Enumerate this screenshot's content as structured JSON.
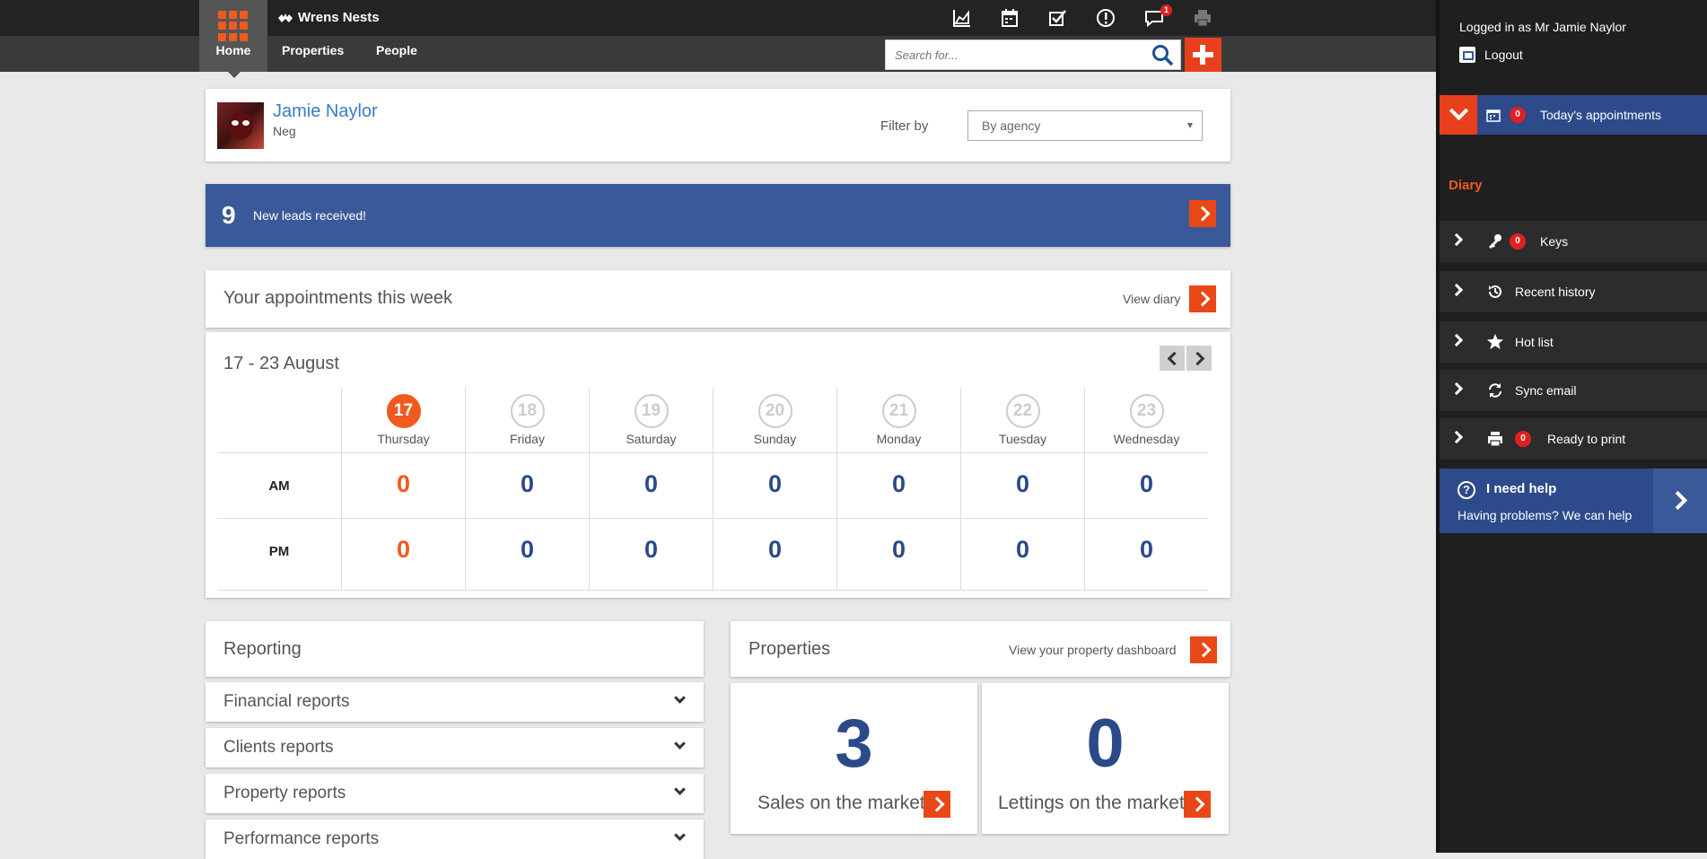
{
  "header": {
    "brand": "Wrens Nests",
    "nav": {
      "home": "Home",
      "properties": "Properties",
      "people": "People"
    },
    "icons": [
      "chart-icon",
      "calendar-icon",
      "checklist-icon",
      "alert-icon",
      "messages-icon",
      "print-icon"
    ],
    "messages_badge": "1",
    "search_placeholder": "Search for..."
  },
  "profile": {
    "name": "Jamie Naylor",
    "role": "Neg",
    "filter_label": "Filter by",
    "filter_value": "By agency"
  },
  "leads": {
    "count": "9",
    "text": "New leads received!"
  },
  "appointments": {
    "title": "Your appointments this week",
    "view_link": "View diary",
    "range": "17 - 23 August",
    "row_labels": [
      "AM",
      "PM"
    ],
    "days": [
      {
        "num": "17",
        "name": "Thursday",
        "am": "0",
        "pm": "0",
        "today": true
      },
      {
        "num": "18",
        "name": "Friday",
        "am": "0",
        "pm": "0",
        "today": false
      },
      {
        "num": "19",
        "name": "Saturday",
        "am": "0",
        "pm": "0",
        "today": false
      },
      {
        "num": "20",
        "name": "Sunday",
        "am": "0",
        "pm": "0",
        "today": false
      },
      {
        "num": "21",
        "name": "Monday",
        "am": "0",
        "pm": "0",
        "today": false
      },
      {
        "num": "22",
        "name": "Tuesday",
        "am": "0",
        "pm": "0",
        "today": false
      },
      {
        "num": "23",
        "name": "Wednesday",
        "am": "0",
        "pm": "0",
        "today": false
      }
    ]
  },
  "reporting": {
    "title": "Reporting",
    "items": [
      "Financial reports",
      "Clients reports",
      "Property reports",
      "Performance reports"
    ]
  },
  "properties": {
    "title": "Properties",
    "view_link": "View your property dashboard",
    "sales": {
      "value": "3",
      "label": "Sales on the market"
    },
    "lettings": {
      "value": "0",
      "label": "Lettings on the market"
    }
  },
  "sidebar": {
    "logged_in": "Logged in as Mr Jamie Naylor",
    "logout": "Logout",
    "today": {
      "count": "0",
      "label": "Today's appointments"
    },
    "diary_label": "Diary",
    "items": [
      {
        "icon": "key-icon",
        "label": "Keys",
        "badge": "0"
      },
      {
        "icon": "history-icon",
        "label": "Recent history",
        "badge": ""
      },
      {
        "icon": "star-icon",
        "label": "Hot list",
        "badge": ""
      },
      {
        "icon": "sync-icon",
        "label": "Sync email",
        "badge": ""
      },
      {
        "icon": "print-icon",
        "label": "Ready to print",
        "badge": "0"
      }
    ],
    "help": {
      "title": "I need help",
      "subtitle": "Having problems? We can help"
    }
  },
  "colors": {
    "accent": "#f05a1f",
    "brand_blue": "#3a5999",
    "number_blue": "#2a4a8a"
  }
}
